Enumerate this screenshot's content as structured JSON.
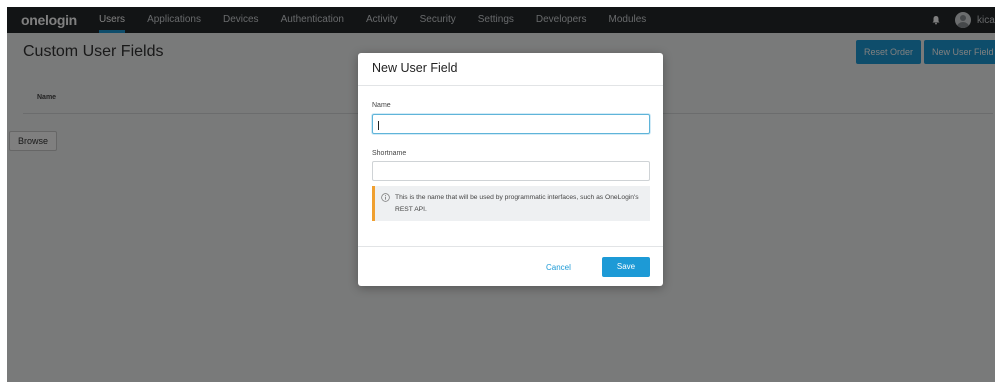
{
  "app": {
    "logo_text": "onelogin"
  },
  "nav": {
    "items": [
      {
        "label": "Users",
        "active": true
      },
      {
        "label": "Applications"
      },
      {
        "label": "Devices"
      },
      {
        "label": "Authentication"
      },
      {
        "label": "Activity"
      },
      {
        "label": "Security"
      },
      {
        "label": "Settings"
      },
      {
        "label": "Developers"
      },
      {
        "label": "Modules"
      }
    ],
    "user_name": "kica",
    "icons": {
      "notifications": "bell-icon",
      "avatar": "user-avatar-icon"
    }
  },
  "page": {
    "title": "Custom User Fields",
    "reset_order_label": "Reset Order",
    "new_user_field_label": "New User Field",
    "table_header_name": "Name",
    "browse_label": "Browse"
  },
  "modal": {
    "title": "New User Field",
    "name_label": "Name",
    "name_value": "",
    "shortname_label": "Shortname",
    "shortname_value": "",
    "hint_text": "This is the name that will be used by programmatic interfaces, such as OneLogin's REST API.",
    "hint_icon": "info-icon",
    "cancel_label": "Cancel",
    "save_label": "Save"
  },
  "colors": {
    "accent": "#1d9ad6",
    "topbar": "#25282a",
    "hint_border": "#f0a030"
  }
}
